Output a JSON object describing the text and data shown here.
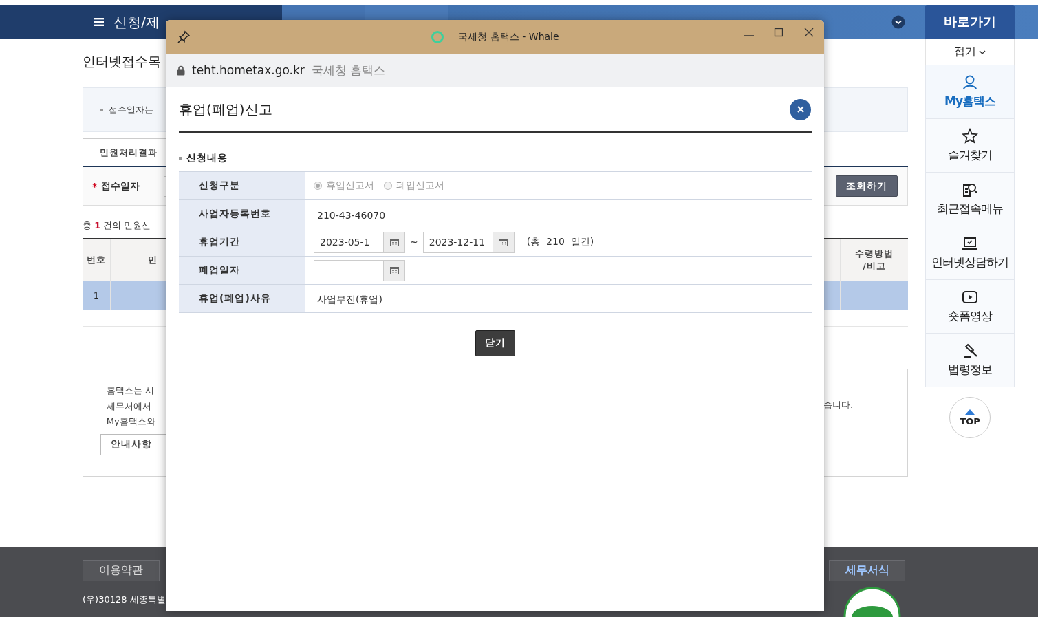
{
  "header": {
    "menu_title": "신청/제"
  },
  "page": {
    "title": "인터넷접수목",
    "notice": "접수일자는",
    "tab": {
      "label": "민원처리결과",
      "selected": true
    },
    "search": {
      "required_mark": "*",
      "label": "접수일자",
      "button": "조회하기"
    },
    "summary": {
      "prefix": "총",
      "count": "1",
      "suffix": "건의 민원신"
    },
    "table": {
      "columns": [
        "번호",
        "민",
        "수령방법\n/비고"
      ],
      "rows": [
        {
          "cells": [
            "1"
          ],
          "selected": true
        }
      ]
    },
    "info": {
      "lines": [
        "- 홈택스는 시",
        "- 세무서에서",
        "- My홈택스와"
      ],
      "tail": "습니다.",
      "button": "안내사항"
    }
  },
  "quick_menu": {
    "title": "바로가기",
    "collapse": "접기",
    "items": [
      {
        "kind": "person",
        "label": "My홈택스",
        "selected": true
      },
      {
        "kind": "star",
        "label": "즐겨찾기",
        "selected": false
      },
      {
        "kind": "recent",
        "label": "최근접속메뉴",
        "selected": false
      },
      {
        "kind": "laptop",
        "label": "인터넷상담하기",
        "selected": false
      },
      {
        "kind": "video",
        "label": "숏폼영상",
        "selected": false
      },
      {
        "kind": "gavel",
        "label": "법령정보",
        "selected": false
      }
    ],
    "top_button": "TOP"
  },
  "footer": {
    "links": [
      "이용약관",
      "세무서식"
    ],
    "address": "(우)30128 세종특별"
  },
  "popup": {
    "title": "국세청 홈택스 - Whale",
    "url": "teht.hometax.go.kr",
    "site_name": "국세청 홈택스",
    "dialog": {
      "title": "휴업(폐업)신고",
      "section": "신청내용",
      "fields": [
        {
          "kind": "radio",
          "label": "신청구분",
          "disabled": true,
          "options": [
            {
              "label": "휴업신고서",
              "selected": true
            },
            {
              "label": "폐업신고서",
              "selected": false
            }
          ]
        },
        {
          "kind": "text",
          "label": "사업자등록번호",
          "value": "210-43-46070"
        },
        {
          "kind": "date_range",
          "label": "휴업기간",
          "from": "2023-05-1",
          "to": "2023-12-11",
          "separator": "~",
          "total": "(총  210  일간)"
        },
        {
          "kind": "date",
          "label": "폐업일자"
        },
        {
          "kind": "text",
          "label": "휴업(폐업)사유",
          "value": "사업부진(휴업)"
        }
      ],
      "close_button": "닫기"
    }
  }
}
